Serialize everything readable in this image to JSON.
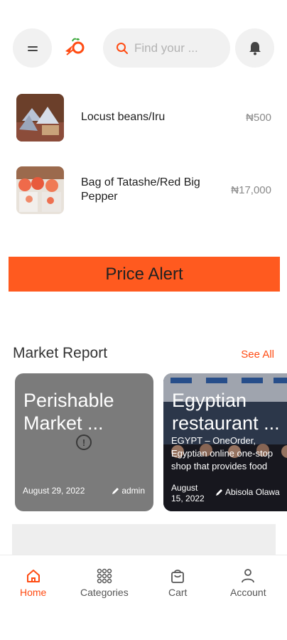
{
  "header": {
    "search_placeholder": "Find your ...",
    "icons": [
      "menu-icon",
      "logo",
      "search-icon",
      "bell-icon"
    ]
  },
  "products": [
    {
      "name": "Locust beans/Iru",
      "price": "₦500"
    },
    {
      "name": "Bag of Tatashe/Red Big Pepper",
      "price": "₦17,000"
    }
  ],
  "price_alert": {
    "label": "Price Alert"
  },
  "market_report": {
    "title": "Market Report",
    "see_all": "See All",
    "cards": [
      {
        "title": "Perishable Market ...",
        "date": "August 29, 2022",
        "author": "admin"
      },
      {
        "title": "Egyptian restaurant ...",
        "excerpt_1": "EGYPT – OneOrder,",
        "excerpt_2": "Egyptian online one-stop",
        "excerpt_3": "shop that provides food",
        "date_1": "August",
        "date_2": "15, 2022",
        "author": "Abisola Olawa"
      }
    ]
  },
  "nav": {
    "home": "Home",
    "categories": "Categories",
    "cart": "Cart",
    "account": "Account"
  },
  "colors": {
    "accent": "#ff4b12",
    "price_alert_bg": "#ff5a1f"
  }
}
